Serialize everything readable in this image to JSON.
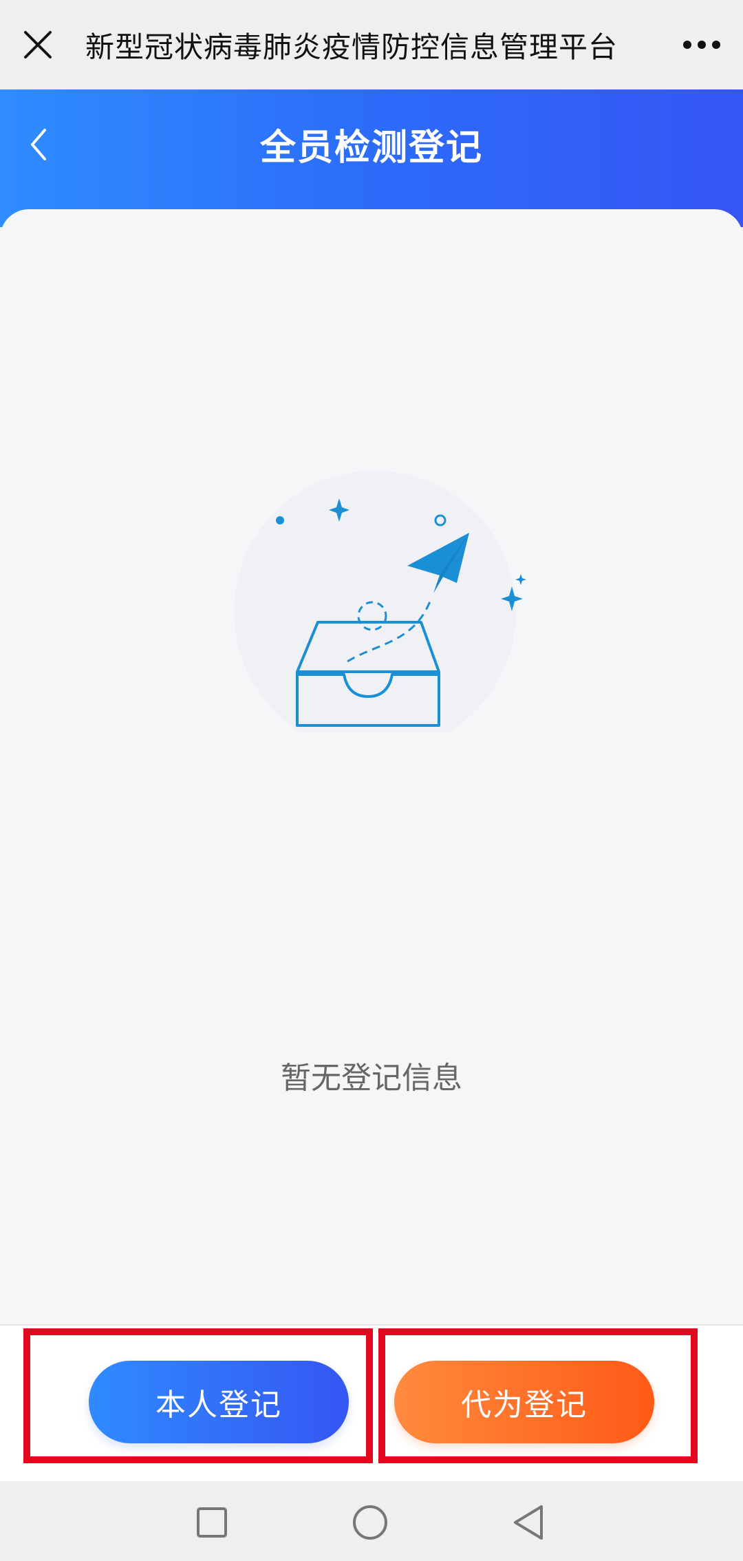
{
  "topbar": {
    "title": "新型冠状病毒肺炎疫情防控信息管理平台",
    "close_icon": "close-icon",
    "more_icon": "more-icon"
  },
  "header": {
    "title": "全员检测登记",
    "back_icon": "chevron-left-icon"
  },
  "empty": {
    "message": "暂无登记信息",
    "illustration_icon": "inbox-paper-plane-icon"
  },
  "actions": {
    "self_label": "本人登记",
    "proxy_label": "代为登记"
  },
  "navbar": {
    "icons": [
      "square-icon",
      "circle-icon",
      "triangle-back-icon"
    ]
  },
  "colors": {
    "header_start": "#2f8cff",
    "header_end": "#3656f4",
    "illustration": "#1b8fd6",
    "self_button_start": "#2f8bff",
    "self_button_end": "#3556f3",
    "proxy_button_start": "#ff8a3d",
    "proxy_button_end": "#ff5a17",
    "highlight_border": "#e3071f"
  }
}
